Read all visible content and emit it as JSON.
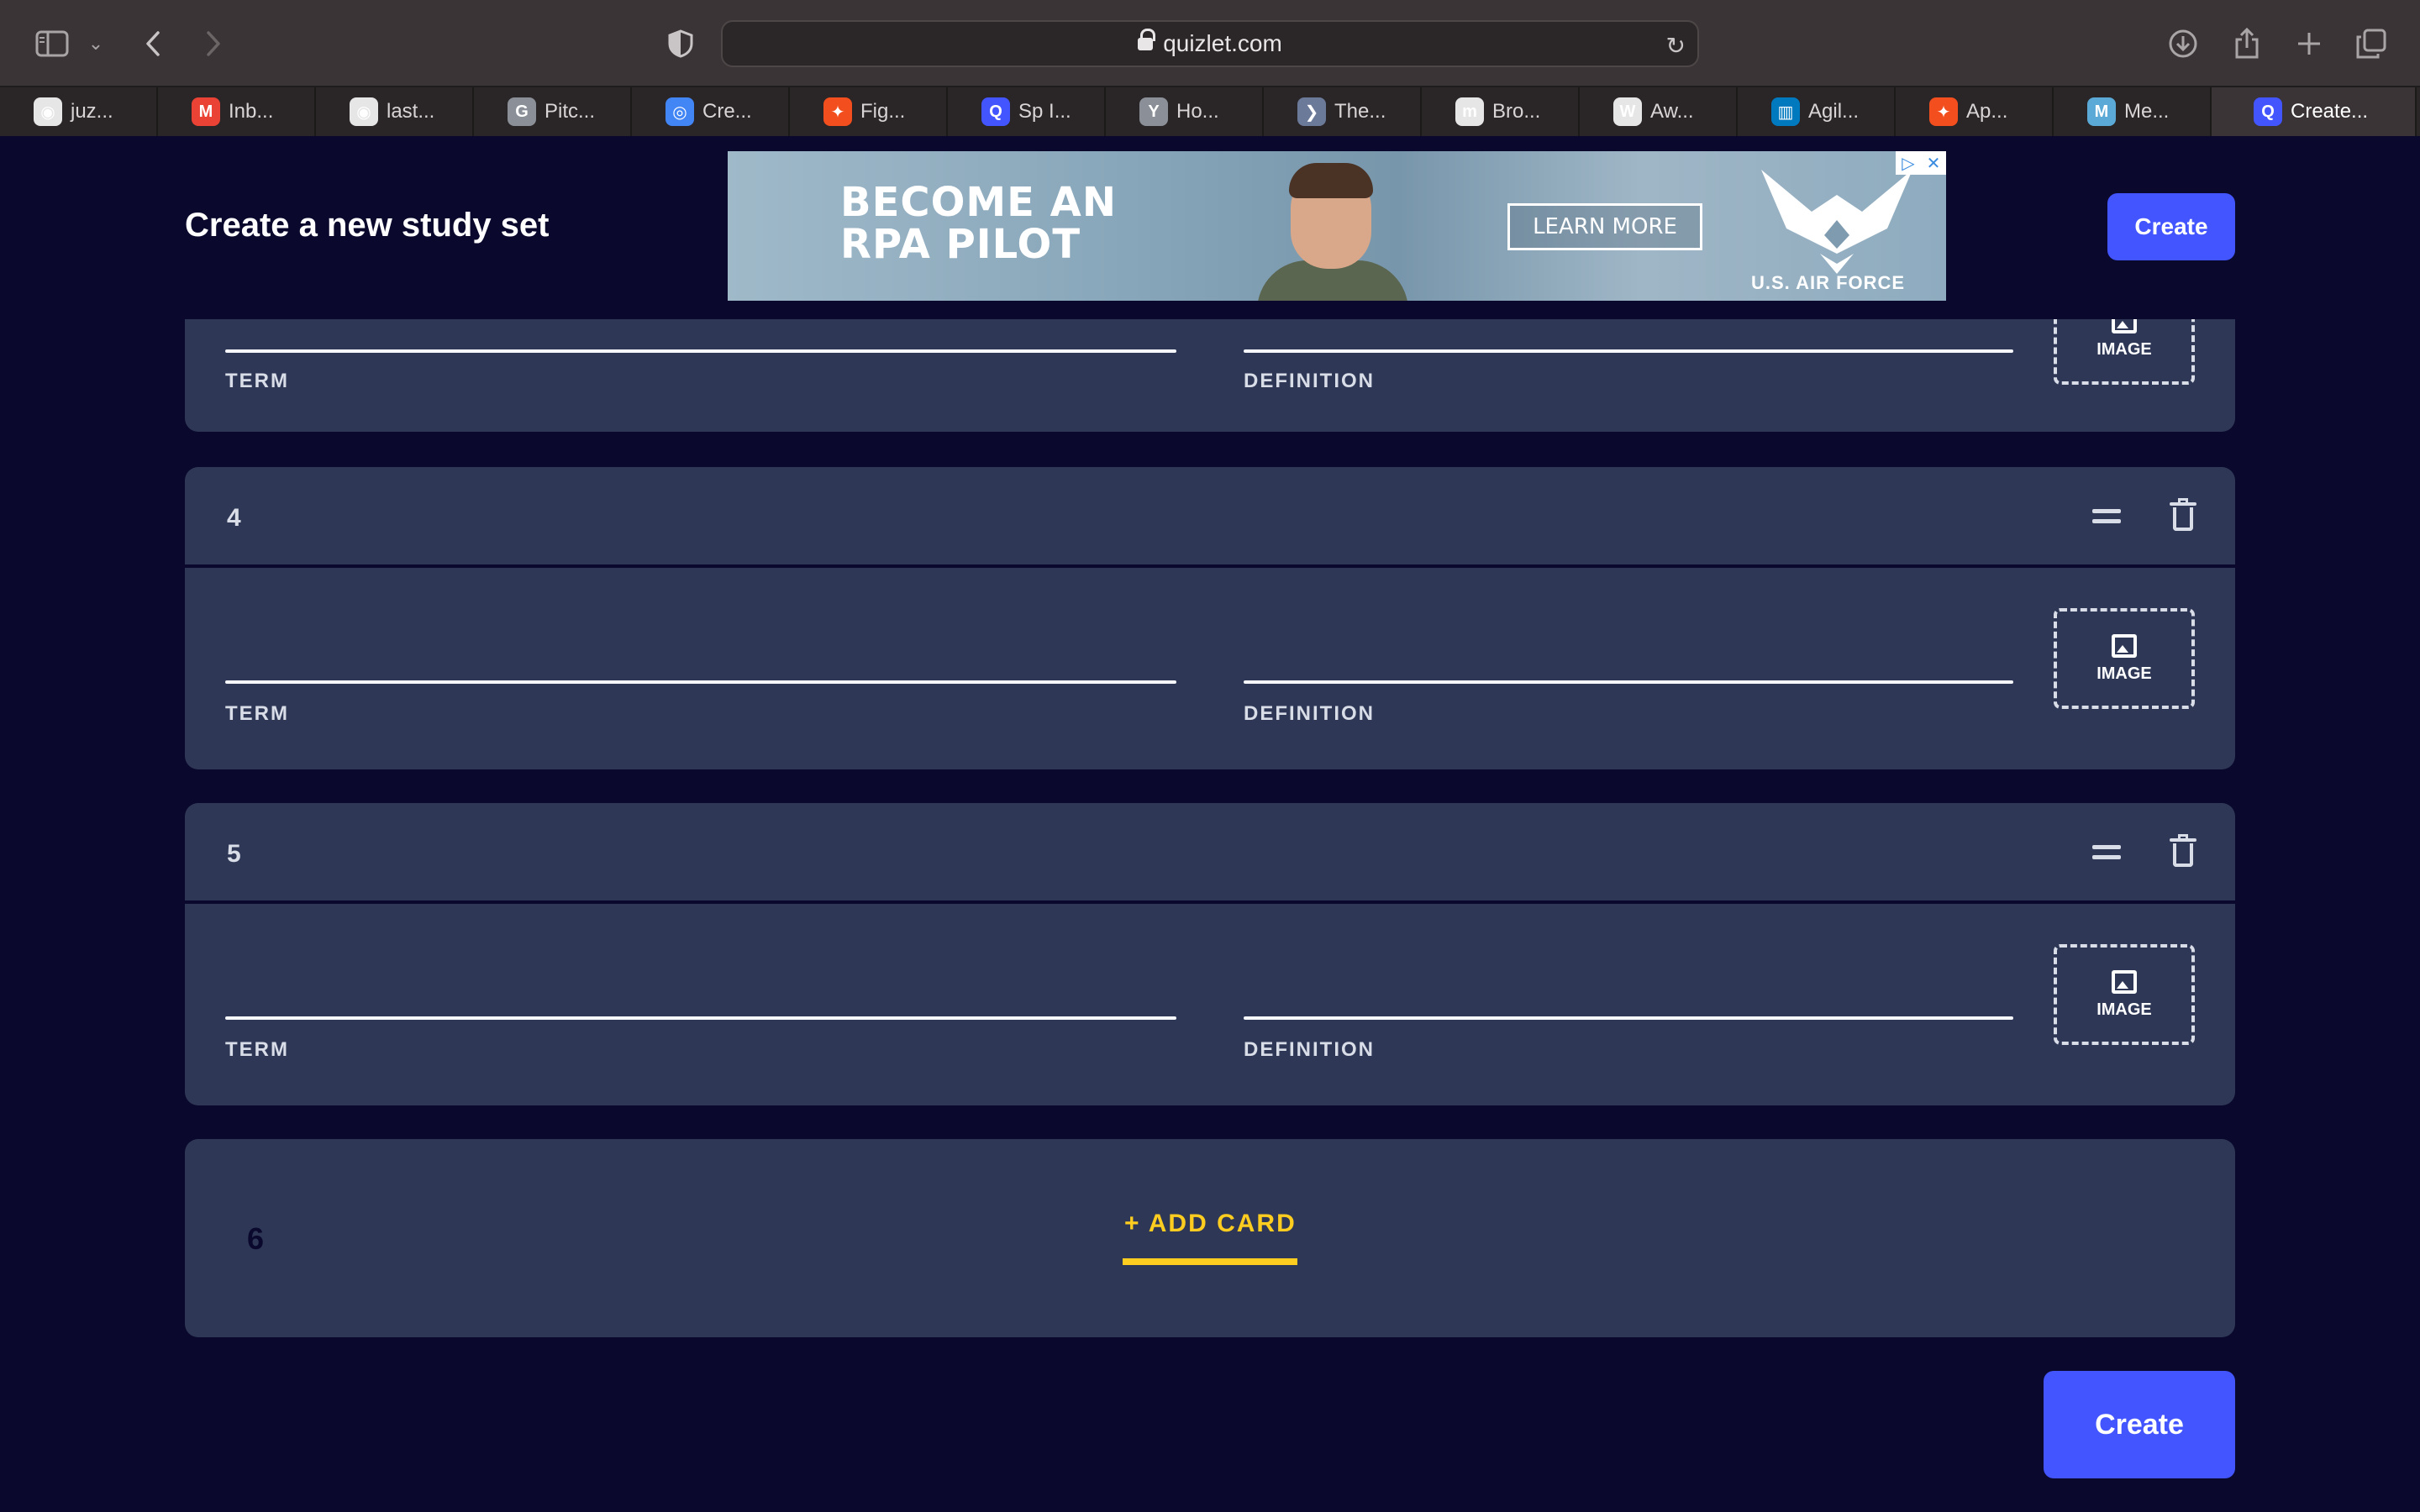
{
  "browser": {
    "url": "quizlet.com",
    "tabs": [
      {
        "label": "juz...",
        "favicon": "github-icon",
        "color": "#e6e6e6",
        "glyph": "◉"
      },
      {
        "label": "Inb...",
        "favicon": "gmail-icon",
        "color": "#ea4335",
        "glyph": "M"
      },
      {
        "label": "last...",
        "favicon": "github-icon",
        "color": "#e6e6e6",
        "glyph": "◉"
      },
      {
        "label": "Pitc...",
        "favicon": "g-icon",
        "color": "#8a8f98",
        "glyph": "G"
      },
      {
        "label": "Cre...",
        "favicon": "chrome-icon",
        "color": "#4285f4",
        "glyph": "◎"
      },
      {
        "label": "Fig...",
        "favicon": "figma-icon",
        "color": "#f24e1e",
        "glyph": "✦"
      },
      {
        "label": "Sp I...",
        "favicon": "quizlet-icon",
        "color": "#4255ff",
        "glyph": "Q"
      },
      {
        "label": "Ho...",
        "favicon": "y-icon",
        "color": "#8a8f98",
        "glyph": "Y"
      },
      {
        "label": "The...",
        "favicon": "chevron-icon",
        "color": "#6c7a9a",
        "glyph": "❯"
      },
      {
        "label": "Bro...",
        "favicon": "m-icon",
        "color": "#e6e6e6",
        "glyph": "m"
      },
      {
        "label": "Aw...",
        "favicon": "w-icon",
        "color": "#e6e6e6",
        "glyph": "W"
      },
      {
        "label": "Agil...",
        "favicon": "trello-icon",
        "color": "#0079bf",
        "glyph": "▥"
      },
      {
        "label": "Ap...",
        "favicon": "figma-icon",
        "color": "#f24e1e",
        "glyph": "✦"
      },
      {
        "label": "Me...",
        "favicon": "medium-icon",
        "color": "#5aa9d6",
        "glyph": "M"
      },
      {
        "label": "Create...",
        "favicon": "quizlet-icon",
        "color": "#4255ff",
        "glyph": "Q",
        "active": true
      }
    ]
  },
  "header": {
    "title": "Create a new study set",
    "create_label": "Create"
  },
  "ad": {
    "headline": "BECOME AN RPA PILOT",
    "cta": "LEARN MORE",
    "brand": "U.S. AIR FORCE"
  },
  "cards": [
    {
      "number": "",
      "term_label": "TERM",
      "definition_label": "DEFINITION",
      "image_label": "IMAGE"
    },
    {
      "number": "4",
      "term_label": "TERM",
      "definition_label": "DEFINITION",
      "image_label": "IMAGE"
    },
    {
      "number": "5",
      "term_label": "TERM",
      "definition_label": "DEFINITION",
      "image_label": "IMAGE"
    }
  ],
  "add_card": {
    "number": "6",
    "label": "+ ADD CARD"
  },
  "footer": {
    "create_label": "Create"
  },
  "colors": {
    "page_bg": "#0a092d",
    "card_bg": "#2e3856",
    "primary": "#4255ff",
    "accent": "#ffcd1f"
  }
}
